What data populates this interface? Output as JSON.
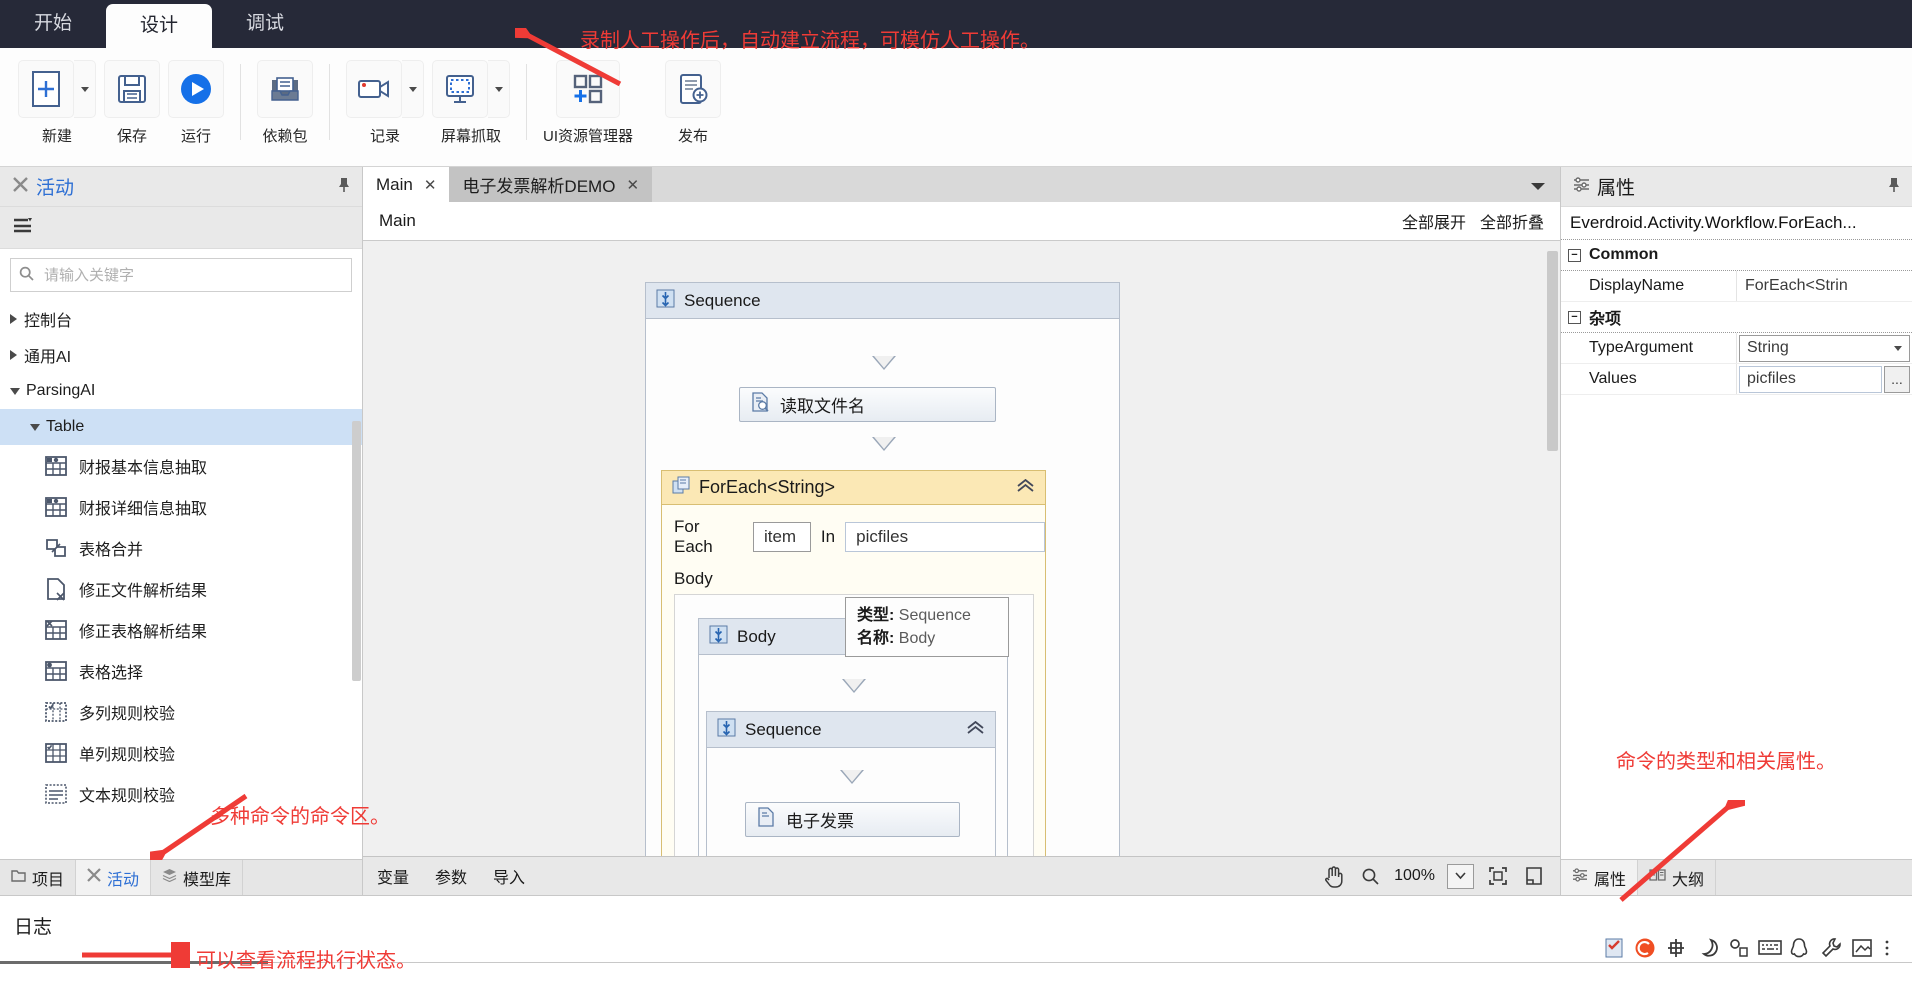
{
  "ribbon": {
    "tabs": [
      {
        "label": "开始",
        "active": false
      },
      {
        "label": "设计",
        "active": true
      },
      {
        "label": "调试",
        "active": false
      }
    ],
    "groups": [
      {
        "items": [
          {
            "label": "新建",
            "icon": "new-document-icon",
            "dropdown": true
          },
          {
            "label": "保存",
            "icon": "save-floppy-icon",
            "dropdown": false
          },
          {
            "label": "运行",
            "icon": "run-play-icon",
            "dropdown": false
          }
        ]
      },
      {
        "items": [
          {
            "label": "依赖包",
            "icon": "package-inbox-icon",
            "dropdown": false
          }
        ]
      },
      {
        "items": [
          {
            "label": "记录",
            "icon": "video-record-icon",
            "dropdown": true
          },
          {
            "label": "屏幕抓取",
            "icon": "screen-capture-icon",
            "dropdown": true
          }
        ]
      },
      {
        "items": [
          {
            "label": "UI资源管理器",
            "icon": "ui-explorer-icon",
            "dropdown": false
          },
          {
            "label": "发布",
            "icon": "publish-icon",
            "dropdown": false
          }
        ]
      }
    ]
  },
  "left_panel": {
    "title": "活动",
    "title_icon": "activities-icon",
    "pin_icon": "pin-icon",
    "filter_icon": "filter-sort-icon",
    "search": {
      "placeholder": "请输入关键字",
      "value": "",
      "icon": "search-icon"
    },
    "tree": [
      {
        "label": "控制台",
        "level": 0,
        "expanded": false,
        "type": "node"
      },
      {
        "label": "通用AI",
        "level": 0,
        "expanded": false,
        "type": "node"
      },
      {
        "label": "ParsingAI",
        "level": 0,
        "expanded": true,
        "type": "node"
      },
      {
        "label": "Table",
        "level": 1,
        "expanded": true,
        "type": "node",
        "selected": true
      },
      {
        "label": "财报基本信息抽取",
        "level": 2,
        "type": "leaf",
        "icon": "table-extract-icon"
      },
      {
        "label": "财报详细信息抽取",
        "level": 2,
        "type": "leaf",
        "icon": "table-extract-icon"
      },
      {
        "label": "表格合并",
        "level": 2,
        "type": "leaf",
        "icon": "table-merge-icon"
      },
      {
        "label": "修正文件解析结果",
        "level": 2,
        "type": "leaf",
        "icon": "file-fix-icon"
      },
      {
        "label": "修正表格解析结果",
        "level": 2,
        "type": "leaf",
        "icon": "table-fix-icon"
      },
      {
        "label": "表格选择",
        "level": 2,
        "type": "leaf",
        "icon": "table-select-icon"
      },
      {
        "label": "多列规则校验",
        "level": 2,
        "type": "leaf",
        "icon": "multi-column-check-icon"
      },
      {
        "label": "单列规则校验",
        "level": 2,
        "type": "leaf",
        "icon": "single-column-check-icon"
      },
      {
        "label": "文本规则校验",
        "level": 2,
        "type": "leaf",
        "icon": "text-rule-check-icon"
      }
    ],
    "bottom_tabs": [
      {
        "label": "项目",
        "icon": "folder-icon",
        "active": false
      },
      {
        "label": "活动",
        "icon": "activities-icon",
        "active": true
      },
      {
        "label": "模型库",
        "icon": "model-library-icon",
        "active": false
      }
    ]
  },
  "designer": {
    "doc_tabs": [
      {
        "label": "Main",
        "active": true,
        "closable": true
      },
      {
        "label": "电子发票解析DEMO",
        "active": false,
        "current": true,
        "closable": true
      }
    ],
    "tabs_overflow_icon": "chevron-down-icon",
    "breadcrumb": "Main",
    "expand_all": "全部展开",
    "collapse_all": "全部折叠",
    "canvas": {
      "sequence": {
        "title": "Sequence",
        "icon": "sequence-icon"
      },
      "read_filename": {
        "title": "读取文件名",
        "icon": "read-file-icon"
      },
      "foreach": {
        "title": "ForEach<String>",
        "icon": "foreach-icon",
        "for_each_label": "For Each",
        "item_value": "item",
        "in_label": "In",
        "in_value": "picfiles",
        "body_label": "Body",
        "inner_body": {
          "title": "Body",
          "icon": "sequence-icon"
        },
        "inner_sequence": {
          "title": "Sequence",
          "icon": "sequence-icon"
        },
        "inner_activity": {
          "title": "电子发票",
          "icon": "read-file-icon"
        }
      },
      "tooltip": {
        "type_label": "类型:",
        "type_value": "Sequence",
        "name_label": "名称:",
        "name_value": "Body"
      }
    },
    "status_bar": {
      "links": [
        "变量",
        "参数",
        "导入"
      ],
      "pan_icon": "hand-pan-icon",
      "zoom_icon": "magnifier-icon",
      "zoom_level": "100%",
      "zoom_dropdown_icon": "chevron-down-icon",
      "fit_icon": "fit-to-screen-icon",
      "reset_icon": "reset-view-icon"
    }
  },
  "properties": {
    "title": "属性",
    "title_icon": "properties-icon",
    "pin_icon": "pin-icon",
    "type_name": "Everdroid.Activity.Workflow.ForEach...",
    "groups": [
      {
        "name": "Common",
        "rows": [
          {
            "key": "DisplayName",
            "value": "ForEach<Strin",
            "control": "text"
          }
        ]
      },
      {
        "name": "杂项",
        "rows": [
          {
            "key": "TypeArgument",
            "value": "String",
            "control": "select"
          },
          {
            "key": "Values",
            "value": "picfiles",
            "control": "input-ellipsis",
            "ellipsis": "..."
          }
        ]
      }
    ],
    "bottom_tabs": [
      {
        "label": "属性",
        "icon": "properties-icon",
        "active": true
      },
      {
        "label": "大纲",
        "icon": "outline-book-icon",
        "active": false
      }
    ]
  },
  "log": {
    "title": "日志"
  },
  "annotations": [
    {
      "id": "record-note",
      "text": "录制人工操作后，自动建立流程，可模仿人工操作。"
    },
    {
      "id": "commands-note",
      "text": "多种命令的命令区。"
    },
    {
      "id": "properties-note",
      "text": "命令的类型和相关属性。"
    },
    {
      "id": "log-note",
      "text": "可以查看流程执行状态。"
    }
  ],
  "colors": {
    "ribbon_bg": "#262938",
    "accent_blue": "#2d6fd4",
    "annotation_red": "#ef3b36",
    "selection_blue": "#cde0f5",
    "foreach_yellow": "#fbe8b5"
  }
}
